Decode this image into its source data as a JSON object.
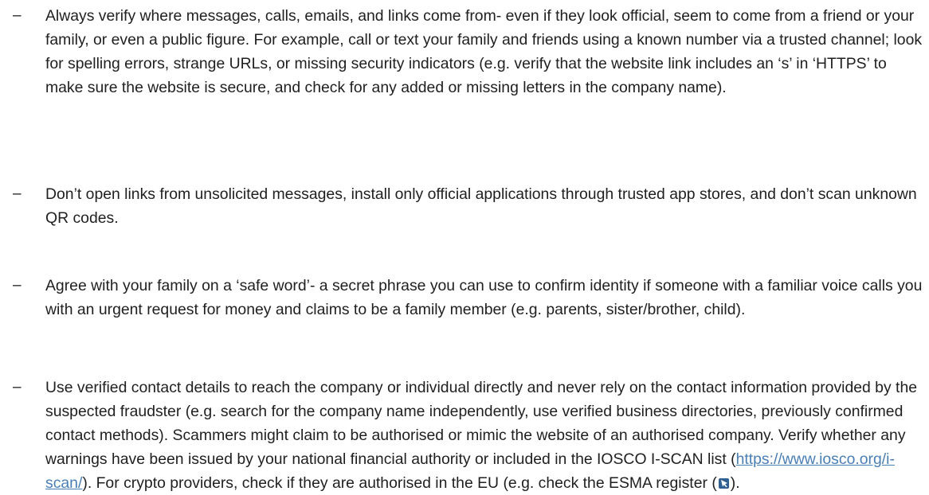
{
  "bullets": [
    {
      "marker": "–",
      "text": "Always verify where messages, calls, emails, and links come from- even if they look official, seem to come from a friend or your family, or even a public figure. For example, call or text your family and friends using a known number via a trusted channel; look for spelling errors, strange URLs, or missing security indicators (e.g. verify that the website link includes an ‘s’ in ‘HTTPS’ to make sure the website is secure, and check for any added or missing letters in the company name)."
    },
    {
      "marker": "–",
      "text": "Don’t open links from unsolicited messages, install only official applications through trusted app stores, and don’t scan unknown QR codes."
    },
    {
      "marker": "–",
      "text": "Agree with your family on a ‘safe word’- a secret phrase you can use to confirm identity if someone with a familiar voice calls you with an urgent request for money and claims to be a family member (e.g. parents, sister/brother, child)."
    },
    {
      "marker": "–",
      "text_before_link": "Use verified contact details to reach the company or individual directly and never rely on the contact information provided by the suspected fraudster (e.g. search for the company name independently, use verified business directories, previously confirmed contact methods). Scammers might claim to be authorised or mimic the website of an authorised company. Verify whether any warnings have been issued by your national financial authority or included in the IOSCO I-SCAN list (",
      "link": "https://www.iosco.org/i-scan/",
      "text_after_link": "). For crypto providers, check if they are authorised in the EU (e.g. check the ESMA register (",
      "icon": "external-link-arrow-icon",
      "text_end": ")."
    }
  ],
  "colors": {
    "text": "#1f1f1f",
    "link": "#4a7fb5",
    "icon_bg": "#2f5f93"
  }
}
